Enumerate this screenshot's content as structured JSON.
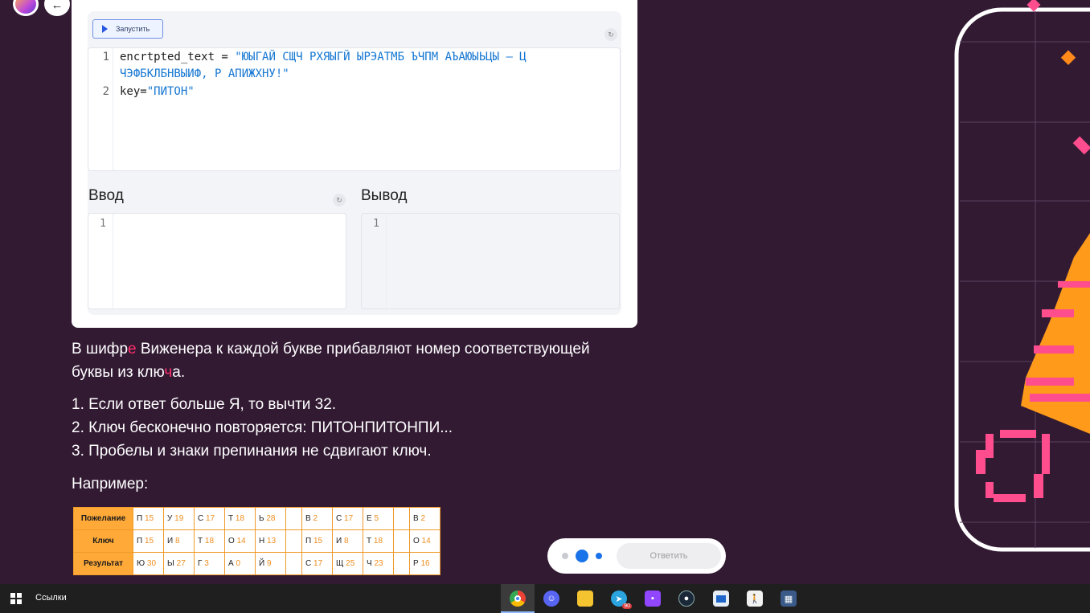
{
  "editor": {
    "run_label": "Запустить",
    "reset_glyph": "↻",
    "code_lines": [
      {
        "num": "1",
        "prefix": "encrtpted_text = ",
        "string": "\"ЮЫГАЙ СЩЧ РХЯЫГЙ ЫРЭАТМБ ЪЧПМ АЪАЮЫЬЦЫ — Ц"
      },
      {
        "num": "",
        "prefix": "",
        "string": "ЧЭФБКЛБНВЫИФ, Р АПИЖХНУ!\""
      },
      {
        "num": "2",
        "prefix": "key=",
        "string": "\"ПИТОН\""
      }
    ],
    "input_title": "Ввод",
    "output_title": "Вывод",
    "input_line": "1",
    "output_line": "1"
  },
  "description": {
    "p1_a": "В шифр",
    "p1_b": "е",
    "p1_c": " Виженера к каждой букве прибавляют номер соответствующей",
    "p2_a": "буквы из клю",
    "p2_b": "ч",
    "p2_c": "а.",
    "rule1": "1. Если ответ больше Я, то вычти 32.",
    "rule2": "2. Ключ бесконечно повторяется: ПИТОНПИТОНПИ...",
    "rule3": "3. Пробелы и знаки препинания не сдвигают ключ.",
    "example": "Например:"
  },
  "table": {
    "rows": [
      {
        "label": "Пожелание",
        "cells": [
          [
            "П",
            "15"
          ],
          [
            "У",
            "19"
          ],
          [
            "С",
            "17"
          ],
          [
            "Т",
            "18"
          ],
          [
            "Ь",
            "28"
          ],
          [
            "",
            ""
          ],
          [
            "В",
            "2"
          ],
          [
            "С",
            "17"
          ],
          [
            "Е",
            "5"
          ],
          [
            "",
            ""
          ],
          [
            "В",
            "2"
          ]
        ]
      },
      {
        "label": "Ключ",
        "cells": [
          [
            "П",
            "15"
          ],
          [
            "И",
            "8"
          ],
          [
            "Т",
            "18"
          ],
          [
            "О",
            "14"
          ],
          [
            "Н",
            "13"
          ],
          [
            "",
            ""
          ],
          [
            "П",
            "15"
          ],
          [
            "И",
            "8"
          ],
          [
            "Т",
            "18"
          ],
          [
            "",
            ""
          ],
          [
            "О",
            "14"
          ]
        ]
      },
      {
        "label": "Результат",
        "cells": [
          [
            "Ю",
            "30"
          ],
          [
            "Ы",
            "27"
          ],
          [
            "Г",
            "3"
          ],
          [
            "А",
            "0"
          ],
          [
            "Й",
            "9"
          ],
          [
            "",
            ""
          ],
          [
            "С",
            "17"
          ],
          [
            "Щ",
            "25"
          ],
          [
            "Ч",
            "23"
          ],
          [
            "",
            ""
          ],
          [
            "Р",
            "16"
          ]
        ]
      }
    ]
  },
  "progress": {
    "answer_label": "Ответить",
    "current_step": 2,
    "total_steps": 3
  },
  "taskbar": {
    "links_label": "Ссылки",
    "telegram_badge": "90"
  },
  "colors": {
    "page_bg": "#321a33",
    "accent_pink": "#ff2f6d",
    "accent_orange": "#ffa938",
    "progress_blue": "#1a73e8"
  }
}
